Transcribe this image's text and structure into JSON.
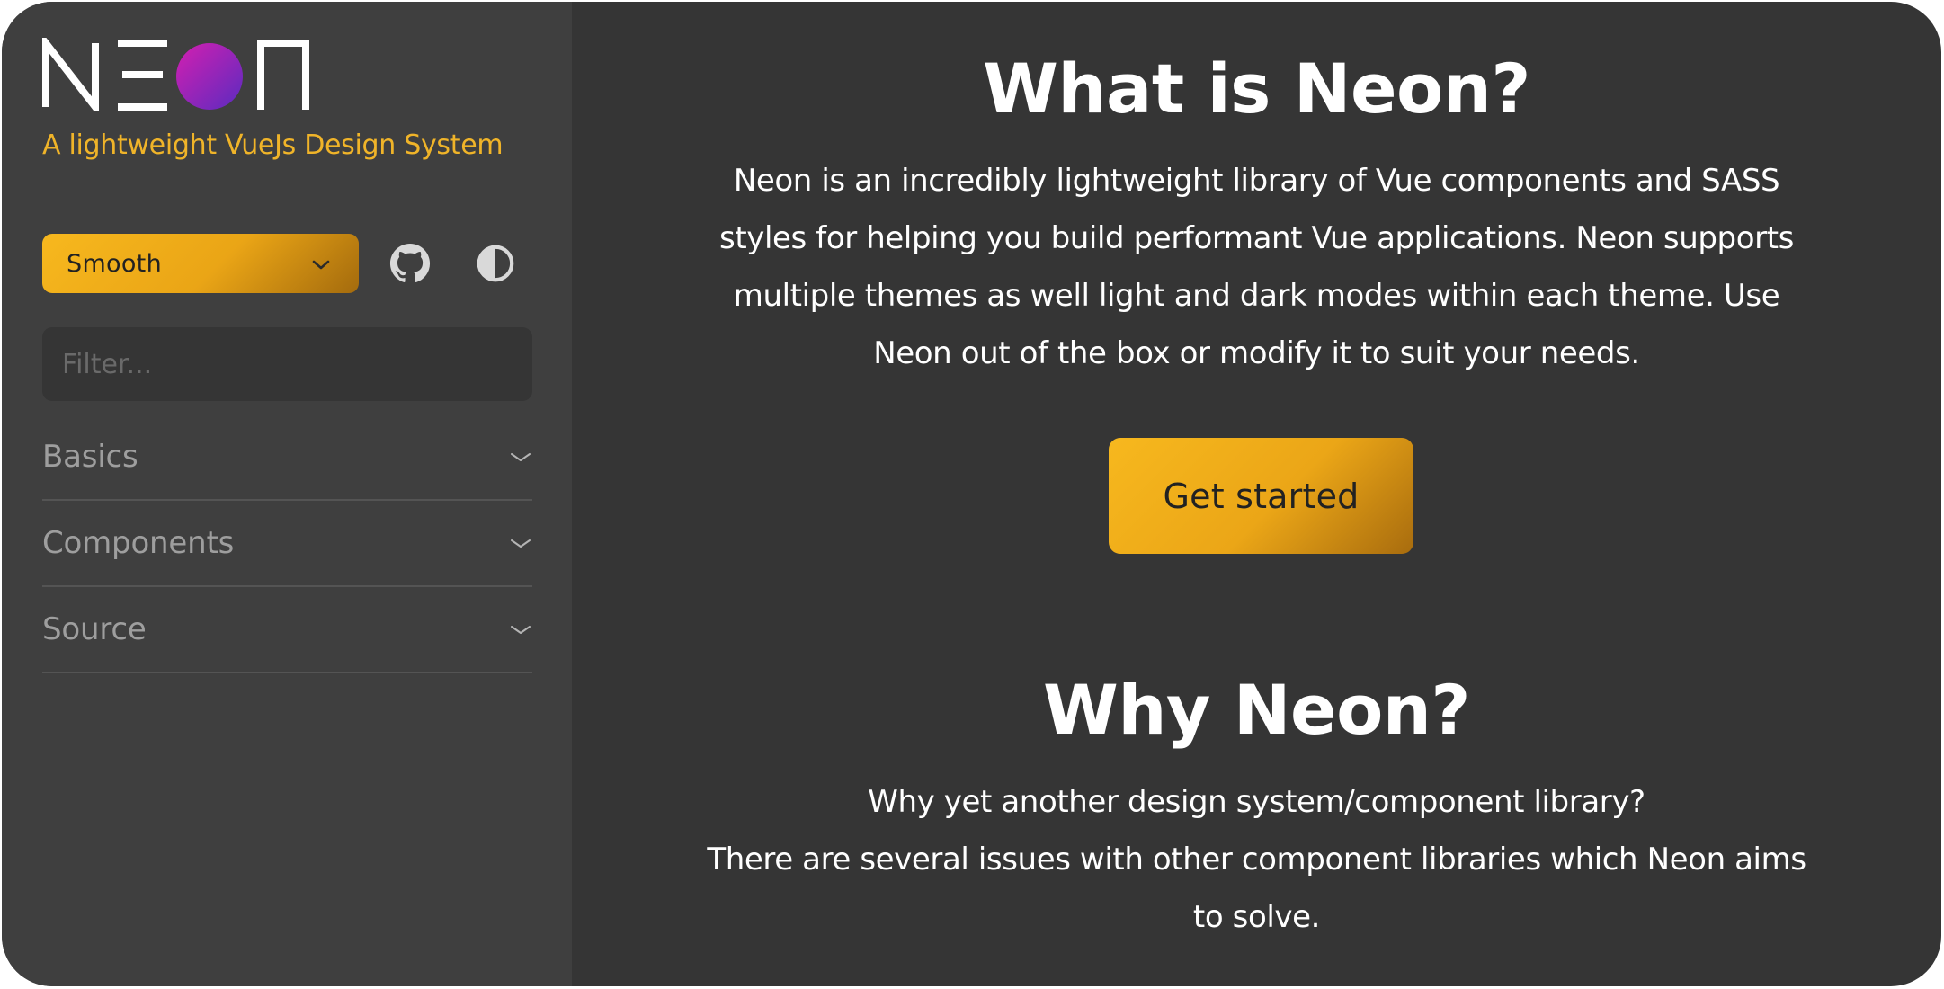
{
  "sidebar": {
    "logo_text": "NEON",
    "tagline": "A lightweight VueJs Design System",
    "theme_select": {
      "value": "Smooth",
      "icon": "chevron-down-icon"
    },
    "github_icon": "github-icon",
    "contrast_icon": "contrast-icon",
    "filter": {
      "placeholder": "Filter..."
    },
    "nav_items": [
      {
        "label": "Basics",
        "icon": "chevron-down-icon"
      },
      {
        "label": "Components",
        "icon": "chevron-down-icon"
      },
      {
        "label": "Source",
        "icon": "chevron-down-icon"
      }
    ]
  },
  "main": {
    "what_heading": "What is Neon?",
    "what_lines": [
      "Neon is an incredibly lightweight library of Vue components and SASS",
      "styles for helping you build performant Vue applications. Neon supports",
      "multiple themes as well light and dark modes within each theme. Use",
      "Neon out of the box or modify it to suit your needs."
    ],
    "cta_label": "Get started",
    "why_heading": "Why Neon?",
    "why_lines": [
      "Why yet another design system/component library?",
      "There are several issues with other component libraries which Neon aims",
      "to solve."
    ]
  },
  "colors": {
    "accent": "#f0b429",
    "logo_gradient_start": "#d11fb0",
    "logo_gradient_end": "#5b2bbf",
    "sidebar_bg": "#3f3f3f",
    "main_bg": "#353535"
  }
}
